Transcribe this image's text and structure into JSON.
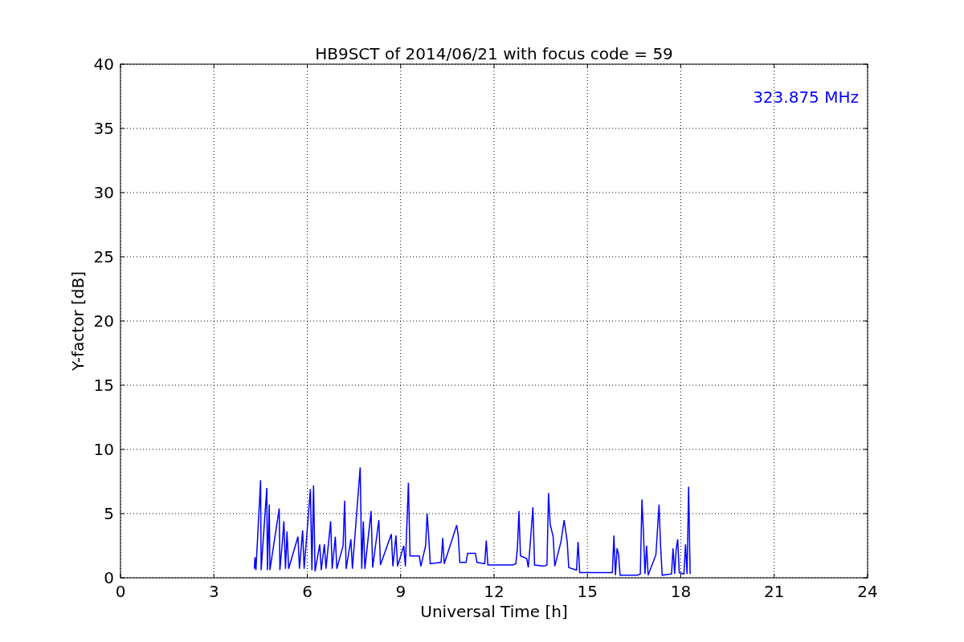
{
  "chart_data": {
    "type": "line",
    "title": "HB9SCT of 2014/06/21 with focus code = 59",
    "xlabel": "Universal Time [h]",
    "ylabel": "Y-factor [dB]",
    "xlim": [
      0,
      24
    ],
    "ylim": [
      0,
      40
    ],
    "xticks": [
      0,
      3,
      6,
      9,
      12,
      15,
      18,
      21,
      24
    ],
    "yticks": [
      0,
      5,
      10,
      15,
      20,
      25,
      30,
      35,
      40
    ],
    "x": [
      4.3,
      4.32,
      4.35,
      4.5,
      4.52,
      4.7,
      4.72,
      4.78,
      4.8,
      5.1,
      5.12,
      5.2,
      5.25,
      5.3,
      5.35,
      5.4,
      5.7,
      5.75,
      5.85,
      5.9,
      6.1,
      6.15,
      6.2,
      6.25,
      6.4,
      6.45,
      6.55,
      6.6,
      6.75,
      6.8,
      6.9,
      6.95,
      7.15,
      7.2,
      7.25,
      7.4,
      7.45,
      7.7,
      7.75,
      7.8,
      7.85,
      8.05,
      8.1,
      8.3,
      8.35,
      8.7,
      8.75,
      8.85,
      8.9,
      9.1,
      9.15,
      9.25,
      9.3,
      9.6,
      9.65,
      9.8,
      9.85,
      9.9,
      9.95,
      10.3,
      10.35,
      10.4,
      10.8,
      10.85,
      10.9,
      11.1,
      11.15,
      11.4,
      11.45,
      11.7,
      11.75,
      11.8,
      12.6,
      12.7,
      12.75,
      12.8,
      12.85,
      13.05,
      13.1,
      13.15,
      13.25,
      13.3,
      13.6,
      13.7,
      13.75,
      13.8,
      13.9,
      13.95,
      14.15,
      14.25,
      14.35,
      14.4,
      14.65,
      14.7,
      14.75,
      15.8,
      15.85,
      15.9,
      15.95,
      16.0,
      16.05,
      16.6,
      16.7,
      16.75,
      16.8,
      16.85,
      16.9,
      16.95,
      17.2,
      17.3,
      17.35,
      17.4,
      17.7,
      17.75,
      17.8,
      17.85,
      17.9,
      17.95,
      18.1,
      18.15,
      18.2,
      18.25,
      18.3
    ],
    "grid": true,
    "series": [
      {
        "color": "#0000ff",
        "values": [
          0.7,
          1.6,
          0.6,
          7.6,
          0.6,
          7.0,
          0.6,
          5.7,
          0.6,
          5.4,
          0.6,
          2.8,
          4.4,
          0.7,
          3.6,
          0.7,
          3.2,
          0.7,
          3.7,
          0.7,
          6.9,
          0.6,
          7.2,
          0.5,
          2.6,
          0.6,
          2.6,
          0.7,
          4.4,
          0.7,
          3.2,
          0.7,
          2.5,
          6.0,
          0.7,
          3.0,
          0.7,
          8.6,
          0.7,
          4.4,
          0.7,
          5.2,
          0.8,
          4.5,
          1.0,
          3.4,
          0.9,
          3.3,
          0.9,
          2.5,
          0.9,
          7.4,
          1.7,
          1.7,
          0.9,
          2.5,
          5.0,
          3.3,
          1.1,
          1.2,
          3.1,
          1.1,
          4.1,
          3.3,
          1.2,
          1.2,
          1.9,
          1.9,
          1.2,
          1.1,
          2.9,
          1.0,
          1.0,
          1.1,
          2.3,
          5.2,
          1.7,
          1.5,
          0.8,
          2.3,
          5.5,
          1.0,
          0.9,
          1.0,
          6.6,
          4.2,
          3.2,
          0.9,
          2.8,
          4.5,
          2.8,
          0.8,
          0.6,
          2.8,
          0.4,
          0.4,
          3.3,
          0.2,
          2.3,
          1.8,
          0.2,
          0.2,
          0.3,
          6.1,
          3.5,
          0.3,
          2.5,
          0.2,
          1.8,
          5.7,
          2.5,
          0.2,
          0.3,
          2.3,
          0.3,
          2.2,
          3.0,
          0.4,
          0.3,
          2.6,
          0.3,
          7.1,
          0.3
        ]
      }
    ],
    "annotations": [
      {
        "text": "323.875 MHz"
      }
    ]
  }
}
